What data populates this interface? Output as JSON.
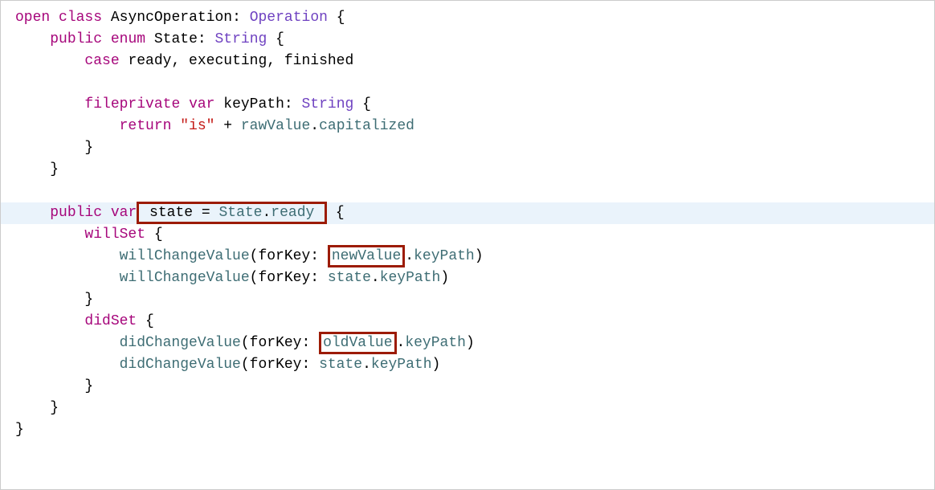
{
  "code": {
    "l1_open": "open",
    "l1_class": "class",
    "l1_name": "AsyncOperation",
    "l1_colon": ": ",
    "l1_super": "Operation",
    "l1_brace": " {",
    "l2_public": "public",
    "l2_enum": "enum",
    "l2_name": "State",
    "l2_colon": ": ",
    "l2_type": "String",
    "l2_brace": " {",
    "l3_case": "case",
    "l3_values": " ready, executing, finished",
    "l5_fileprivate": "fileprivate",
    "l5_var": "var",
    "l5_name": " keyPath: ",
    "l5_type": "String",
    "l5_brace": " {",
    "l6_return": "return",
    "l6_str": "\"is\"",
    "l6_plus": " + ",
    "l6_raw": "rawValue",
    "l6_dot": ".",
    "l6_cap": "capitalized",
    "l7_close": "}",
    "l8_close": "}",
    "l10_public": "public",
    "l10_var": "var",
    "l10_box": " state = ",
    "l10_state": "State",
    "l10_dot": ".",
    "l10_ready": "ready ",
    "l10_brace": "{",
    "l11_willSet": "willSet",
    "l11_brace": " {",
    "l12_func": "willChangeValue",
    "l12_sig": "(forKey: ",
    "l12_newValue": "newValue",
    "l12_dot": ".",
    "l12_keyPath": "keyPath",
    "l12_close": ")",
    "l13_func": "willChangeValue",
    "l13_sig": "(forKey: ",
    "l13_state": "state",
    "l13_dot": ".",
    "l13_keyPath": "keyPath",
    "l13_close": ")",
    "l14_close": "}",
    "l15_didSet": "didSet",
    "l15_brace": " {",
    "l16_func": "didChangeValue",
    "l16_sig": "(forKey: ",
    "l16_oldValue": "oldValue",
    "l16_dot": ".",
    "l16_keyPath": "keyPath",
    "l16_close": ")",
    "l17_func": "didChangeValue",
    "l17_sig": "(forKey: ",
    "l17_state": "state",
    "l17_dot": ".",
    "l17_keyPath": "keyPath",
    "l17_close": ")",
    "l18_close": "}",
    "l19_close": "}",
    "l20_close": "}"
  }
}
